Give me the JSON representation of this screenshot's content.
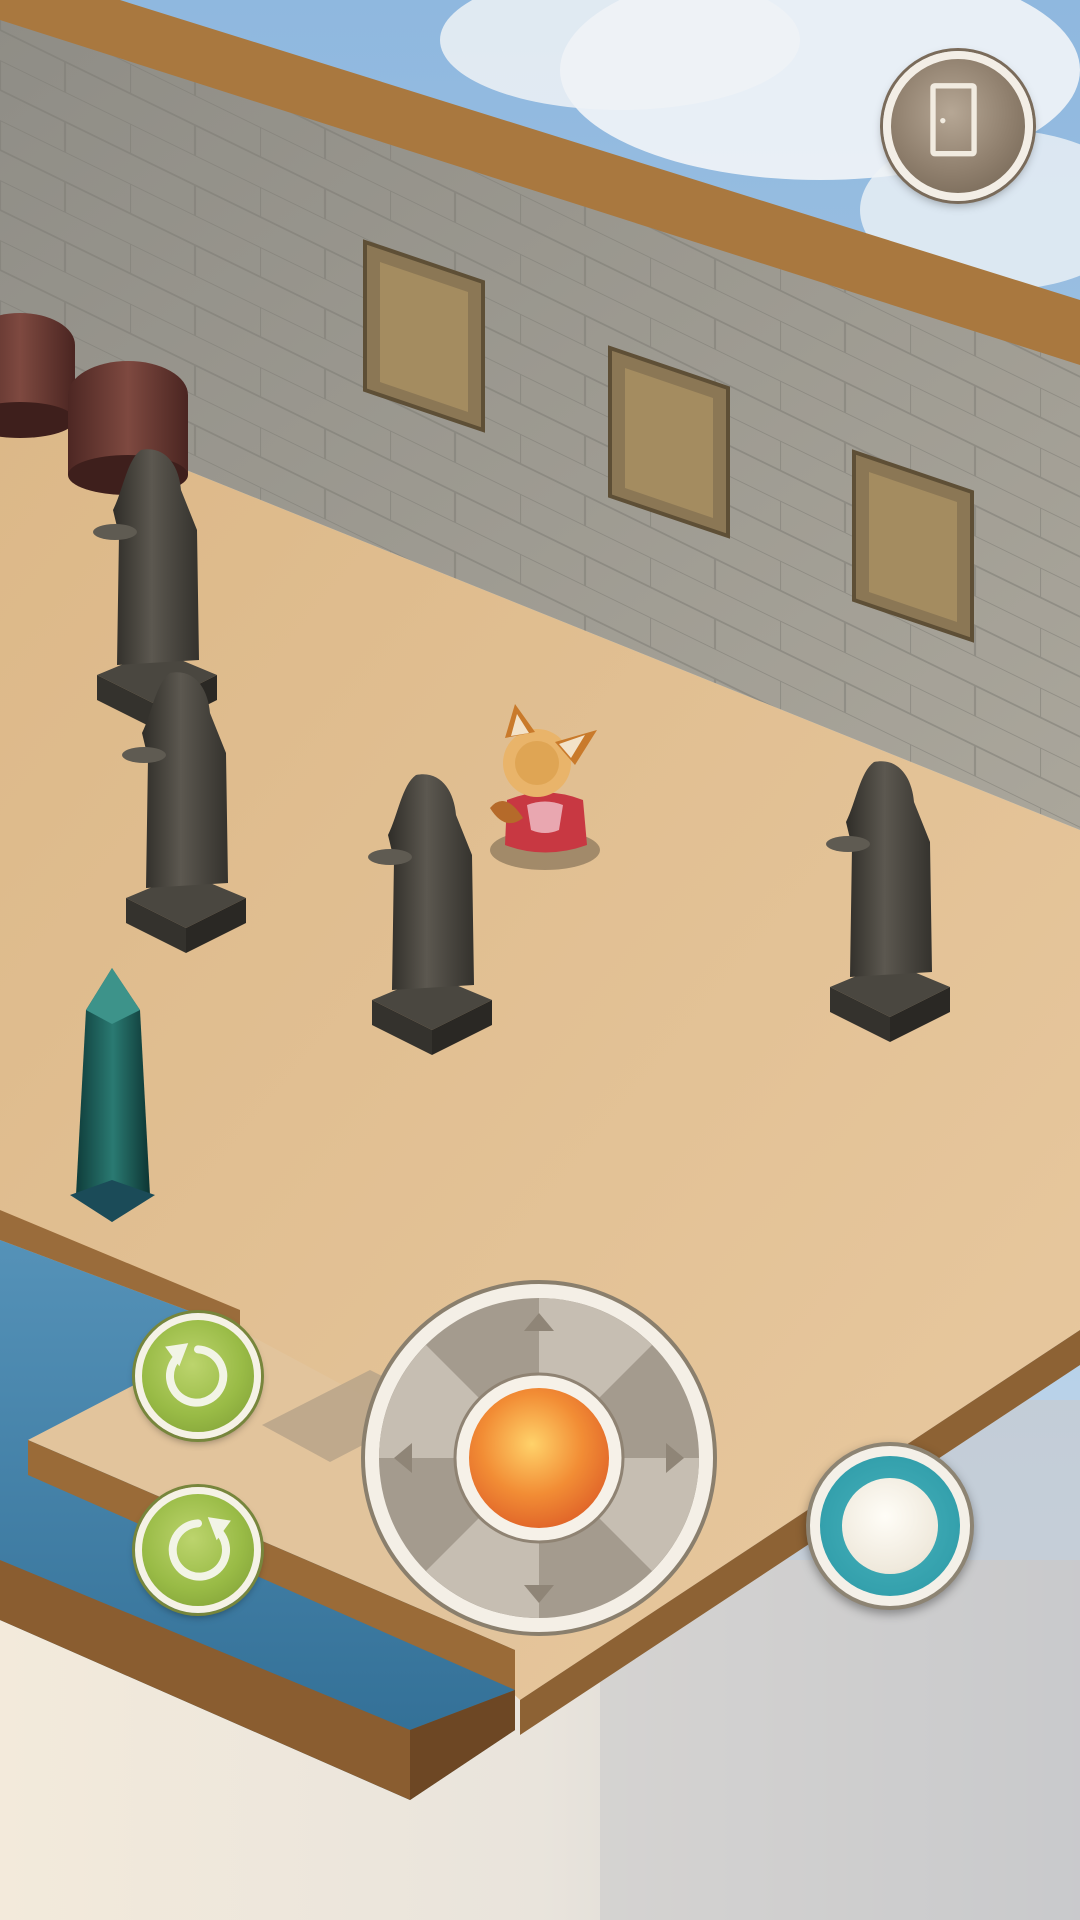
{
  "hud": {
    "exit_icon": "door-icon",
    "rotate_left_icon": "rotate-counterclockwise-icon",
    "rotate_right_icon": "rotate-clockwise-icon",
    "joystick_icon": "directional-pad",
    "action_icon": "action-circle"
  },
  "colors": {
    "sky": "#9fc3e4",
    "cloud": "#f4f6f8",
    "wall": "#9d9a90",
    "wall_top": "#b07f43",
    "floor": "#e1bf94",
    "water": "#3f7fa4",
    "ledge": "#8d6234",
    "statue": "#46433c",
    "obelisk": "#1c5a55",
    "jar": "#6b3a34",
    "joystick_center": "#f08a36",
    "action_ring": "#2b98a5",
    "rotate_buttons": "#99bb46"
  }
}
